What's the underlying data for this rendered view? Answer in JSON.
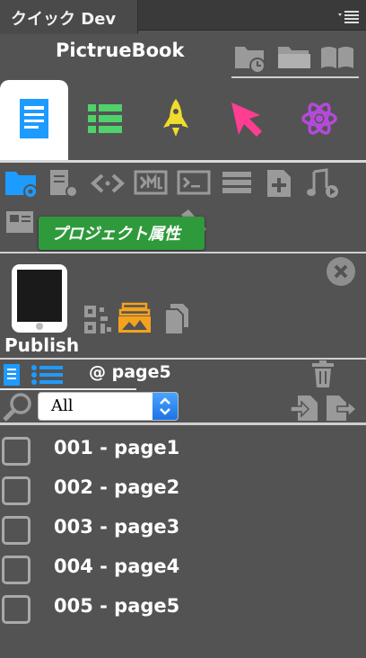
{
  "panel": {
    "tab_label": "クイック Dev"
  },
  "header": {
    "title": "PictrueBook"
  },
  "tooltip": {
    "text": "プロジェクト属性"
  },
  "publish": {
    "label": "Publish"
  },
  "page_toolbar": {
    "current_page": "@ page5"
  },
  "filter": {
    "value": "All"
  },
  "pages": [
    "001 - page1",
    "002 - page2",
    "003 - page3",
    "004 - page4",
    "005 - page5"
  ],
  "colors": {
    "background": "#535353",
    "tooltip": "#2f9a3b",
    "accent_blue": "#1e9bff",
    "green": "#4fd16b",
    "yellow": "#f0dc2c",
    "pink": "#ff3d92",
    "purple": "#b44ad8",
    "orange": "#f3a21f"
  }
}
